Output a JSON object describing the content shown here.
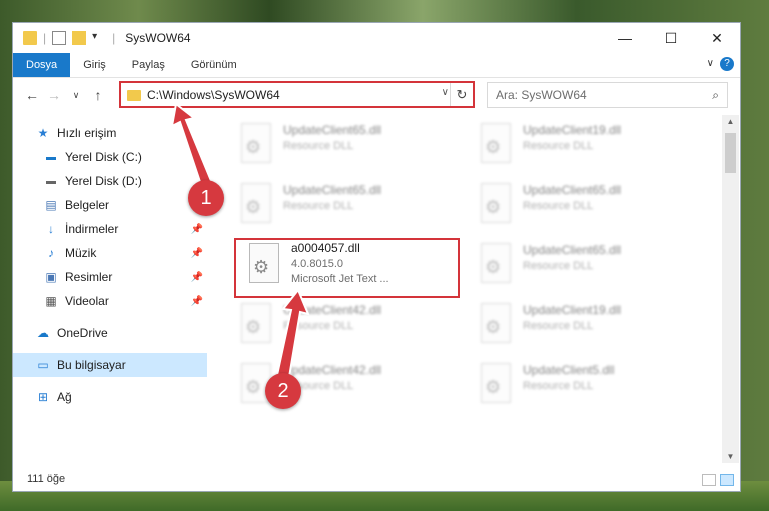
{
  "window": {
    "title": "SysWOW64",
    "controls": {
      "minimize": "—",
      "maximize": "☐",
      "close": "✕"
    }
  },
  "ribbon": {
    "tabs": [
      "Dosya",
      "Giriş",
      "Paylaş",
      "Görünüm"
    ],
    "help": "?"
  },
  "address": {
    "path": "C:\\Windows\\SysWOW64"
  },
  "search": {
    "placeholder": "Ara: SysWOW64"
  },
  "sidebar": {
    "items": [
      {
        "label": "Hızlı erişim",
        "icon": "star-icon",
        "pinned": false
      },
      {
        "label": "Yerel Disk (C:)",
        "icon": "windows-drive-icon",
        "pinned": false
      },
      {
        "label": "Yerel Disk (D:)",
        "icon": "drive-icon",
        "pinned": false
      },
      {
        "label": "Belgeler",
        "icon": "documents-icon",
        "pinned": false
      },
      {
        "label": "İndirmeler",
        "icon": "download-icon",
        "pinned": true
      },
      {
        "label": "Müzik",
        "icon": "music-icon",
        "pinned": true
      },
      {
        "label": "Resimler",
        "icon": "pictures-icon",
        "pinned": true
      },
      {
        "label": "Videolar",
        "icon": "videos-icon",
        "pinned": true
      },
      {
        "label": "OneDrive",
        "icon": "cloud-icon",
        "pinned": false
      },
      {
        "label": "Bu bilgisayar",
        "icon": "computer-icon",
        "pinned": false
      },
      {
        "label": "Ağ",
        "icon": "network-icon",
        "pinned": false
      }
    ]
  },
  "files": [
    {
      "name": "UpdateClient65.dll",
      "sub1": "Resource DLL",
      "sub2": ""
    },
    {
      "name": "UpdateClient19.dll",
      "sub1": "Resource DLL",
      "sub2": ""
    },
    {
      "name": "UpdateClient65.dll",
      "sub1": "Resource DLL",
      "sub2": ""
    },
    {
      "name": "UpdateClient65.dll",
      "sub1": "Resource DLL",
      "sub2": ""
    },
    {
      "name": "a0004057.dll",
      "sub1": "4.0.8015.0",
      "sub2": "Microsoft Jet Text ..."
    },
    {
      "name": "UpdateClient65.dll",
      "sub1": "Resource DLL",
      "sub2": ""
    },
    {
      "name": "UpdateClient42.dll",
      "sub1": "Resource DLL",
      "sub2": ""
    },
    {
      "name": "UpdateClient19.dll",
      "sub1": "Resource DLL",
      "sub2": ""
    },
    {
      "name": "UpdateClient42.dll",
      "sub1": "Resource DLL",
      "sub2": ""
    },
    {
      "name": "UpdateClient5.dll",
      "sub1": "Resource DLL",
      "sub2": ""
    }
  ],
  "status": {
    "count": "111 öğe"
  },
  "annotations": {
    "badge1": "1",
    "badge2": "2",
    "color": "#d6393f"
  }
}
